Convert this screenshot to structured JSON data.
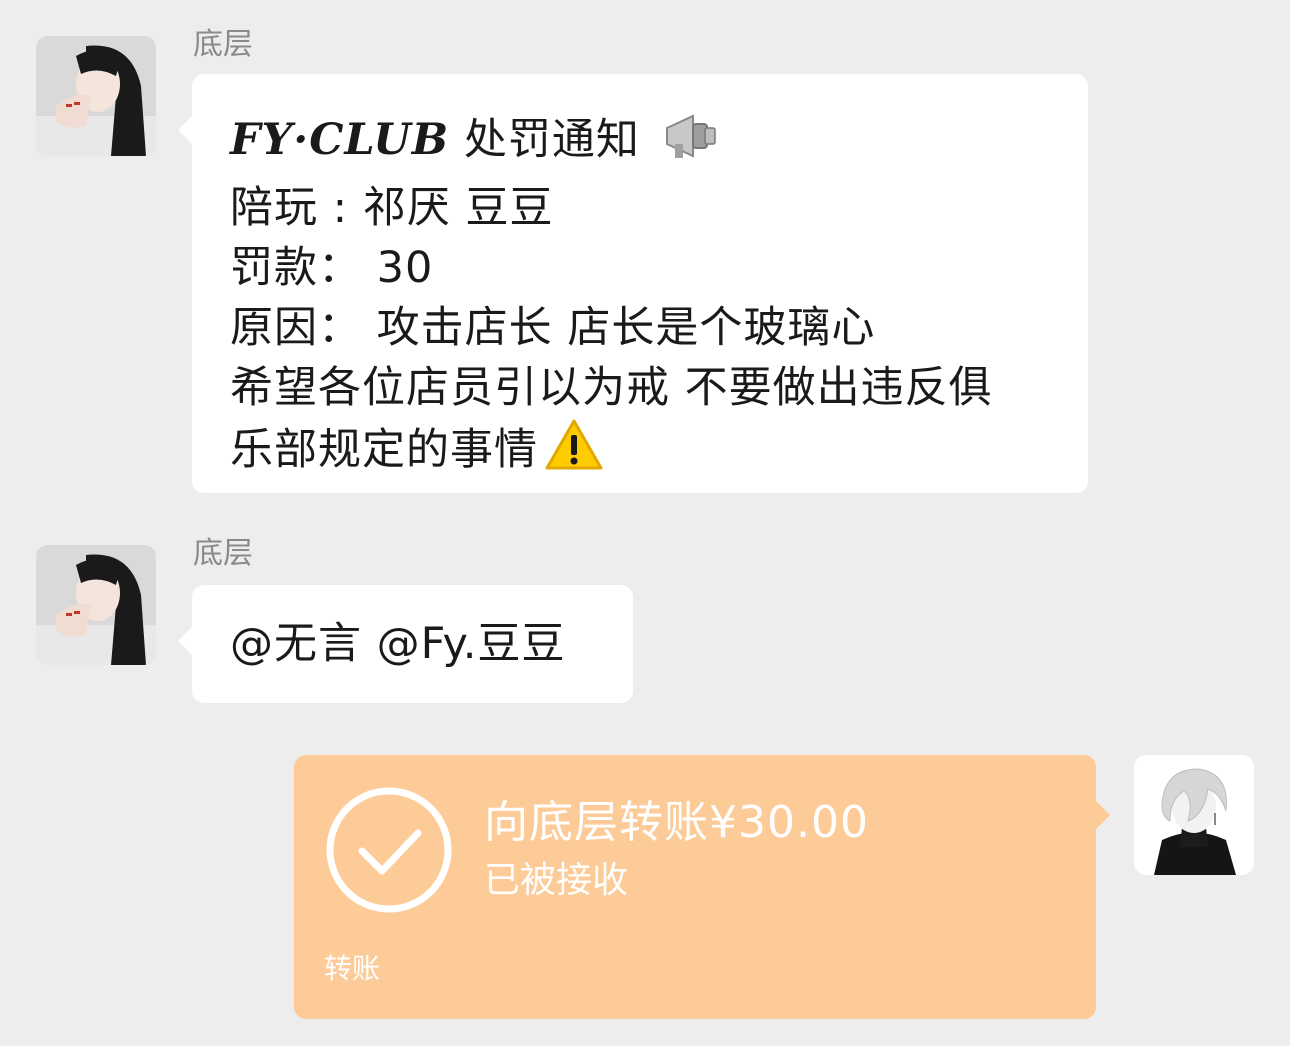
{
  "messages": [
    {
      "sender": "底层",
      "avatar_icon": "girl-portrait-avatar",
      "club_name": "FY·CLUB",
      "title_rest": "处罚通知",
      "title_emoji": "loudspeaker-icon",
      "lines": [
        "陪玩 : 祁厌 豆豆",
        "罚款：  30",
        "原因：  攻击店长 店长是个玻璃心",
        "希望各位店员引以为戒 不要做出违反俱",
        "乐部规定的事情"
      ],
      "end_emoji": "warning-icon"
    },
    {
      "sender": "底层",
      "avatar_icon": "girl-portrait-avatar",
      "text": "@无言 @Fy.豆豆"
    }
  ],
  "transfer": {
    "title": "向底层转账¥30.00",
    "status": "已被接收",
    "label": "转账",
    "icon": "check-circle-icon",
    "color": "#fccb98",
    "self_avatar_icon": "white-hair-boy-avatar"
  }
}
